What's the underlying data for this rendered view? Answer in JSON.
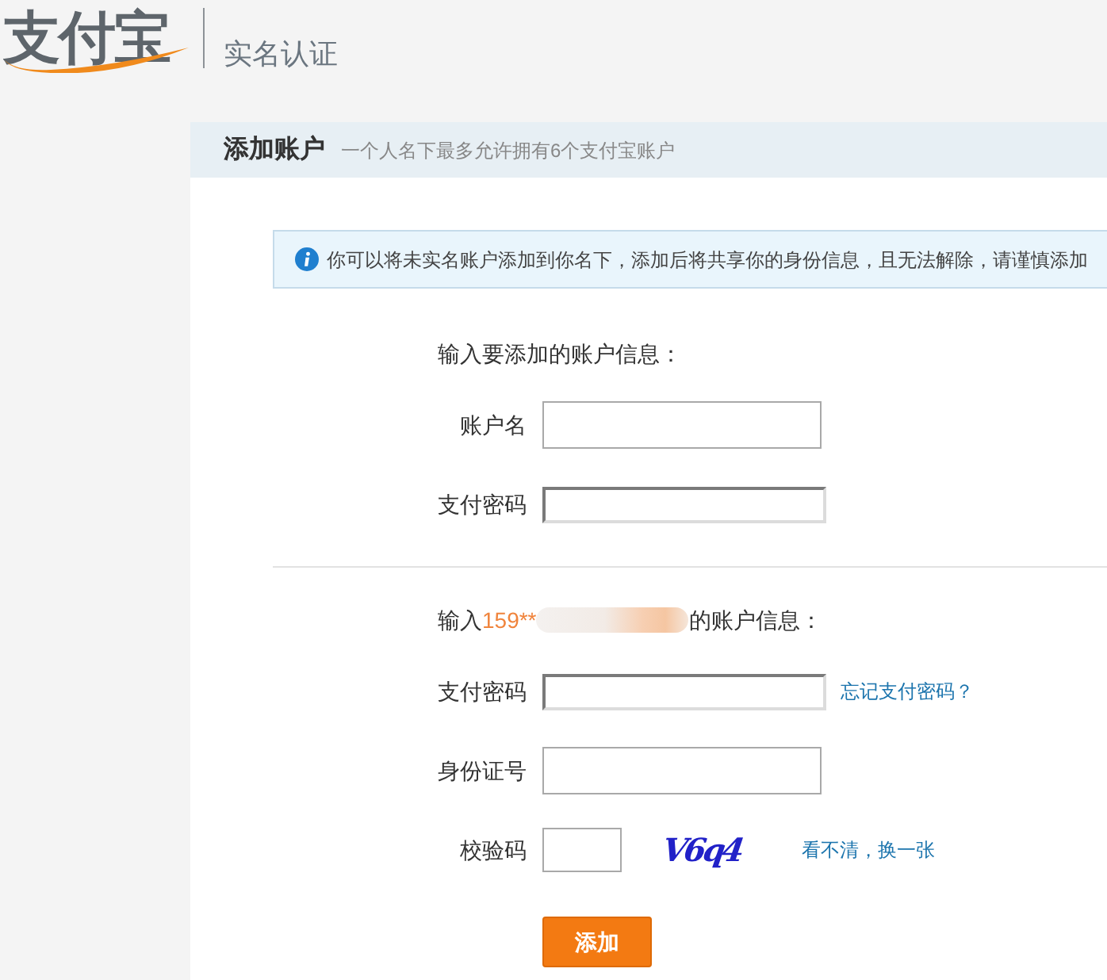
{
  "header": {
    "logo": "支付宝",
    "title": "实名认证"
  },
  "panel": {
    "title": "添加账户",
    "subtitle": "一个人名下最多允许拥有6个支付宝账户"
  },
  "notice": {
    "text": "你可以将未实名账户添加到你名下，添加后将共享你的身份信息，且无法解除，请谨慎添加"
  },
  "sections": [
    {
      "heading": "输入要添加的账户信息：",
      "fields": [
        {
          "kind": "text",
          "label": "账户名"
        },
        {
          "kind": "password",
          "label": "支付密码"
        }
      ]
    },
    {
      "heading_prefix": "输入",
      "account": "159**",
      "account_blurred": true,
      "heading_suffix": "的账户信息：",
      "fields": [
        {
          "kind": "password",
          "label": "支付密码",
          "link": "忘记支付密码？"
        },
        {
          "kind": "text",
          "label": "身份证号"
        },
        {
          "kind": "captcha",
          "label": "校验码",
          "captcha": "V6q4",
          "link": "看不清，换一张"
        }
      ]
    }
  ],
  "submit_button": "添加"
}
